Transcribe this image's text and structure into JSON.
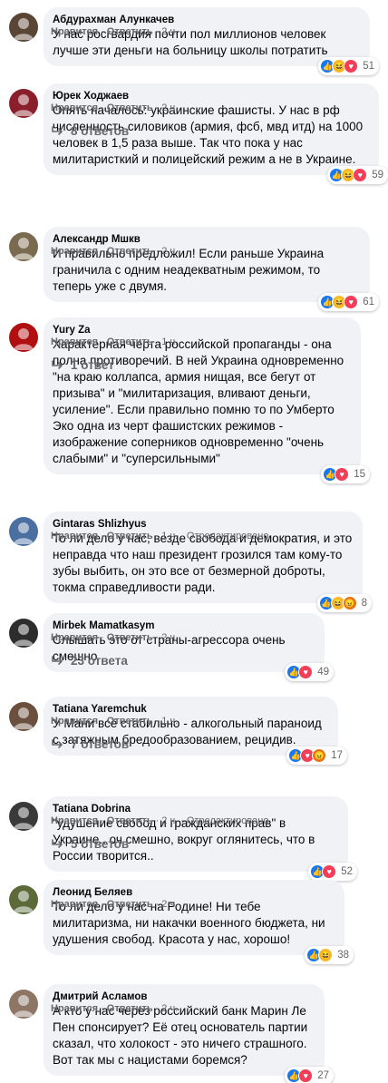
{
  "comments": [
    {
      "author": "Абдурахман Алункачев",
      "text": "У нас росгвардия почти пол миллионов человек лучше эти деньги на больницу школы потратить",
      "like_label": "Нравится",
      "reply_label": "Ответить",
      "time": "2 ч.",
      "reactions": [
        "like",
        "haha",
        "love"
      ],
      "reaction_count": "51",
      "replies_label": ""
    },
    {
      "author": "Юрек Ходжаев",
      "text": "Опять началось: украинские фашисты. У нас в рф численность силовиков (армия, фсб, мвд итд) на 1000 человек в 1,5 раза выше. Так что пока у нас милитаристкий и полицейский режим а не в Украине.",
      "like_label": "Нравится",
      "reply_label": "Ответить",
      "time": "2 ч.",
      "reactions": [
        "like",
        "haha",
        "love"
      ],
      "reaction_count": "59",
      "replies_label": "8 ответов"
    },
    {
      "author": "Александр Мшкв",
      "text": "И правильно предложил! Если раньше Украина граничила с одним неадекватным режимом, то теперь уже с двумя.",
      "like_label": "Нравится",
      "reply_label": "Ответить",
      "time": "2 ч.",
      "reactions": [
        "like",
        "haha",
        "love"
      ],
      "reaction_count": "61",
      "replies_label": ""
    },
    {
      "author": "Yury Za",
      "text": "Характерная черта российской пропаганды - она полна противоречий. В ней Украина одновременно \"на краю коллапса, армия нищая, все бегут от призыва\" и \"милитаризация, вливают деньги, усиление\". Если правильно помню то по Умберто Эко одна из черт фашистских режимов - изображение соперников одновременно \"очень слабыми\" и \"суперсильными\"",
      "like_label": "Нравится",
      "reply_label": "Ответить",
      "time": "1 ч.",
      "reactions": [
        "like",
        "love"
      ],
      "reaction_count": "15",
      "replies_label": "1 ответ"
    },
    {
      "author": "Gintaras Shlizhyus",
      "text": "То ли дело у нас, везде свобода и демократия, и это неправда что наш президент грозился там кому-то зубы выбить, он это все от безмерной доброты, токма справедливости ради.",
      "like_label": "Нравится",
      "reply_label": "Ответить",
      "time": "1 ч.",
      "edited_label": "Отредактировано",
      "reactions": [
        "like",
        "haha",
        "angry"
      ],
      "reaction_count": "8",
      "replies_label": ""
    },
    {
      "author": "Mirbek Mamatkasym",
      "text": "Слышать это от страны-агрессора очень смешно",
      "like_label": "Нравится",
      "reply_label": "Ответить",
      "time": "2 ч.",
      "reactions": [
        "like",
        "love"
      ],
      "reaction_count": "49",
      "replies_label": "23 ответа"
    },
    {
      "author": "Tatiana Yaremchuk",
      "text": "У Мани всё стабильно - алкогольный параноид с затяжным бредообразованием, рецидив.",
      "like_label": "Нравится",
      "reply_label": "Ответить",
      "time": "1 ч.",
      "reactions": [
        "like",
        "love",
        "angry"
      ],
      "reaction_count": "17",
      "replies_label": "7 ответов"
    },
    {
      "author": "Tatiana Dobrina",
      "text": "\"удушение свобод и гражданских прав\" в Украине.. оч смешно, вокруг оглянитесь, что в России творится..",
      "like_label": "Нравится",
      "reply_label": "Ответить",
      "time": "2 ч.",
      "edited_label": "Отредактировано",
      "reactions": [
        "like",
        "love"
      ],
      "reaction_count": "52",
      "replies_label": "5 ответов"
    },
    {
      "author": "Леонид Беляев",
      "text": "То ли дело у нас на Родине! Ни тебе милитаризма, ни накачки военного бюджета, ни удушения свобод. Красота у нас, хорошо!",
      "like_label": "Нравится",
      "reply_label": "Ответить",
      "time": "2 ч.",
      "reactions": [
        "like",
        "haha"
      ],
      "reaction_count": "38",
      "replies_label": ""
    },
    {
      "author": "Дмитрий Асламов",
      "text": "А кто у нас через российский банк Марин Ле Пен спонсирует? Её отец основатель партии сказал, что холокост - это ничего страшного. Вот так мы с нацистами боремся?",
      "like_label": "Нравится",
      "reply_label": "Ответить",
      "time": "2 ч.",
      "reactions": [
        "like",
        "love"
      ],
      "reaction_count": "27",
      "replies_label": ""
    }
  ],
  "colors": {
    "bubble": "#f0f2f5",
    "meta": "#65676b",
    "like": "#1877f2",
    "haha": "#f7b928",
    "love": "#f33e58",
    "angry": "#e9710f"
  }
}
